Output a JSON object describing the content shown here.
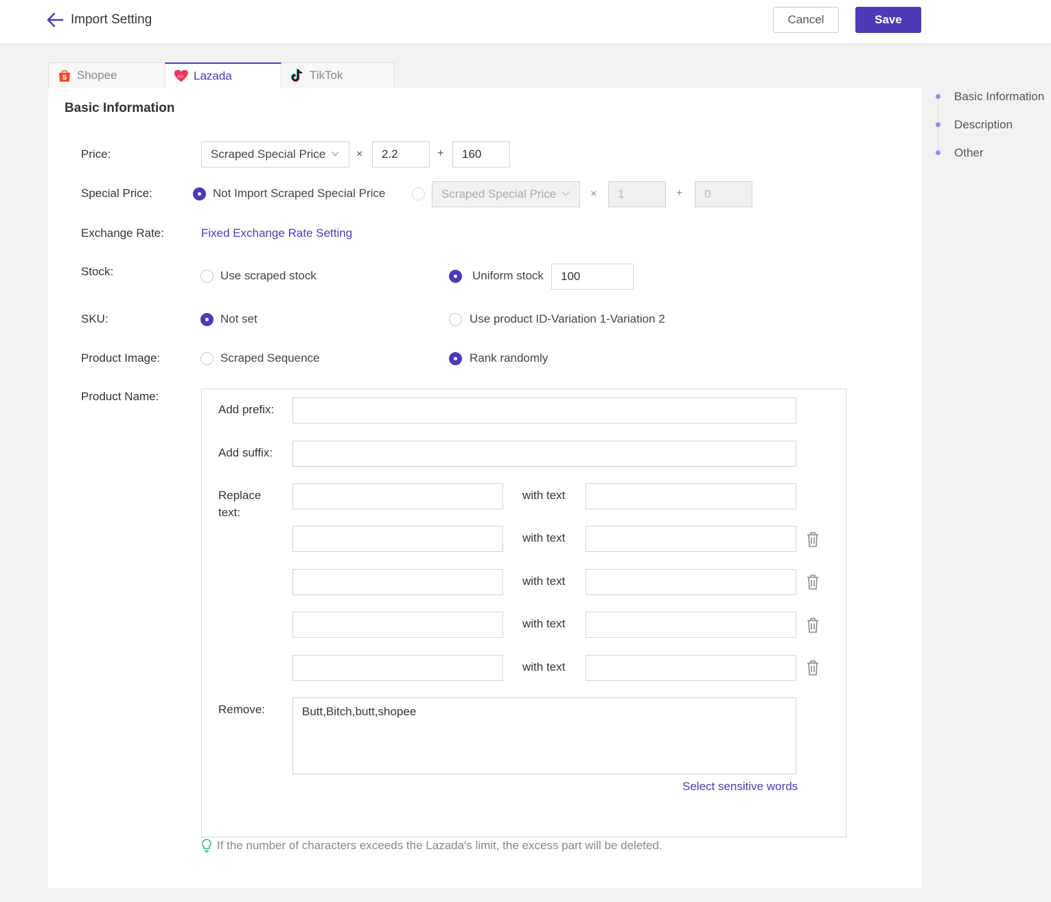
{
  "header": {
    "title": "Import Setting",
    "cancel_label": "Cancel",
    "save_label": "Save"
  },
  "tabs": [
    {
      "label": "Shopee",
      "active": false,
      "icon": "shopee-bag-icon"
    },
    {
      "label": "Lazada",
      "active": true,
      "icon": "lazada-heart-icon"
    },
    {
      "label": "TikTok",
      "active": false,
      "icon": "tiktok-note-icon"
    }
  ],
  "section": {
    "title": "Basic Information"
  },
  "price": {
    "label": "Price:",
    "select": "Scraped Special Price",
    "times_op": "×",
    "multiplier": "2.2",
    "plus_op": "+",
    "addend": "160"
  },
  "special_price": {
    "label": "Special Price:",
    "option_not_import": "Not Import Scraped Special Price",
    "select": "Scraped Special Price",
    "times_op": "×",
    "multiplier": "1",
    "plus_op": "+",
    "addend": "0"
  },
  "exchange_rate": {
    "label": "Exchange Rate:",
    "link": "Fixed Exchange Rate Setting"
  },
  "stock": {
    "label": "Stock:",
    "option_scraped": "Use scraped stock",
    "option_uniform": "Uniform stock",
    "uniform_value": "100",
    "selected": "uniform"
  },
  "sku": {
    "label": "SKU:",
    "option_not_set": "Not set",
    "option_product_id": "Use product ID-Variation 1-Variation 2",
    "selected": "not_set"
  },
  "product_image": {
    "label": "Product Image:",
    "option_sequence": "Scraped Sequence",
    "option_random": "Rank randomly",
    "selected": "random"
  },
  "product_name": {
    "label": "Product Name:",
    "prefix_label": "Add prefix:",
    "prefix_value": "",
    "suffix_label": "Add suffix:",
    "suffix_value": "",
    "replace_label_line1": "Replace",
    "replace_label_line2": "text:",
    "with_text_label": "with text",
    "replace_rows": [
      {
        "find": "",
        "replace": "",
        "with_label": "with text"
      },
      {
        "find": "",
        "replace": "",
        "with_label": "with text"
      },
      {
        "find": "",
        "replace": "",
        "with_label": "with text"
      },
      {
        "find": "",
        "replace": "",
        "with_label": "with text"
      },
      {
        "find": "",
        "replace": "",
        "with_label": "with text"
      }
    ],
    "remove_label": "Remove:",
    "remove_value": "Butt,Bitch,butt,shopee",
    "sensitive_link": "Select sensitive words"
  },
  "tip": "If the number of characters exceeds the Lazada's limit, the excess part will be deleted.",
  "anchor_nav": [
    "Basic Information",
    "Description",
    "Other"
  ],
  "colors": {
    "accent": "#4d3ab7",
    "tip_icon": "#2ebd8a",
    "anchor_dot": "#9b87dc"
  }
}
